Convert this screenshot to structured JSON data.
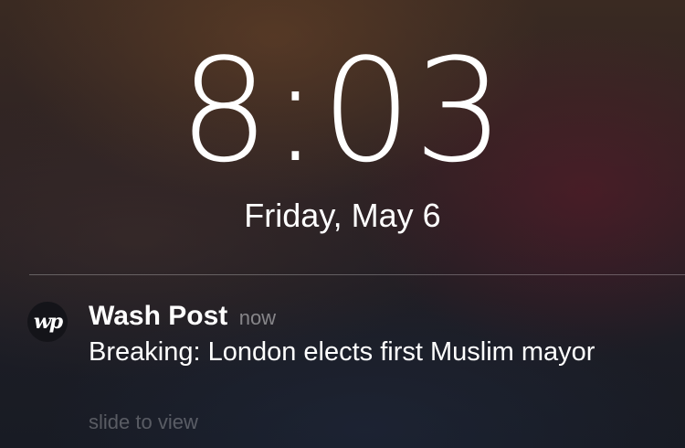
{
  "lockscreen": {
    "time": "8:03",
    "date": "Friday, May 6"
  },
  "notification": {
    "app_icon_text": "wp",
    "app_name": "Wash Post",
    "timestamp": "now",
    "message": "Breaking: London elects first Muslim mayor",
    "action_hint": "slide to view"
  }
}
